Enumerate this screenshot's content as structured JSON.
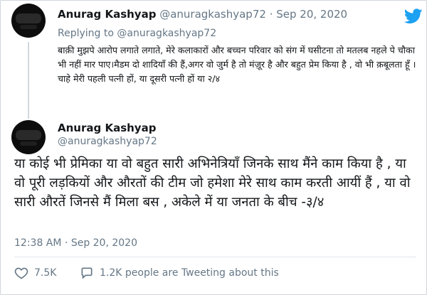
{
  "colors": {
    "twitter_blue": "#1da1f2",
    "muted": "#657786",
    "text": "#14171a",
    "border": "#d0d6db"
  },
  "tweet1": {
    "name": "Anurag Kashyap",
    "handle": "@anuragkashyap72",
    "separator": "·",
    "date": "Sep 20, 2020",
    "reply_prefix": "Replying to",
    "reply_to": "@anuragkashyap72",
    "text": "बाक़ी मुझपे आरोप लगाते लगाते, मेरे कलाकारों और बच्चन परिवार को संग में घसीटना तो मतलब नहले पे चौका भी नहीं मार पाए।मैडम दो शादियाँ की हैं,अगर वो जुर्म है तो मंज़ूर है और बहुत प्रेम किया है , वो भी क़बूलता हूँ । चाहे मेरी पहली पत्नी हों, या दूसरी पत्नी हों या २/४",
    "icon": "twitter-bird-icon"
  },
  "tweet2": {
    "name": "Anurag Kashyap",
    "handle": "@anuragkashyap72",
    "text": "या कोई भी प्रेमिका या वो बहुत सारी अभिनेत्रियाँ जिनके साथ मैंने काम किया है , या वो पूरी लड़कियों और औरतों की टीम जो हमेशा मेरे साथ काम करती आयीं हैं , या वो सारी औरतें जिनसे मैं मिला बस , अकेले में या जनता के बीच -३/४",
    "time": "12:38 AM",
    "separator": "·",
    "date": "Sep 20, 2020",
    "likes": "7.5K",
    "tweeting_about": "1.2K people are Tweeting about this",
    "like_icon": "heart-icon",
    "comment_icon": "speech-bubble-icon"
  }
}
